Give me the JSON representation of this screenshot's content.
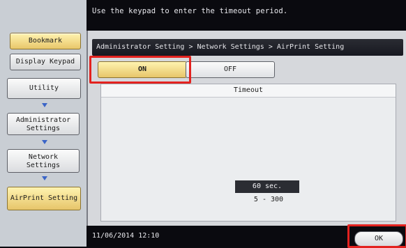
{
  "top": {
    "message": "Use the keypad to enter the timeout period."
  },
  "sidebar": {
    "bookmark": "Bookmark",
    "display_keypad": "Display Keypad",
    "steps": [
      {
        "label": "Utility"
      },
      {
        "label": "Administrator\nSettings"
      },
      {
        "label": "Network\nSettings"
      },
      {
        "label": "AirPrint Setting"
      }
    ]
  },
  "main": {
    "breadcrumb": "Administrator Setting > Network Settings > AirPrint Setting",
    "toggle_on": "ON",
    "toggle_off": "OFF",
    "section_title": "Timeout",
    "timeout_value": "60 sec.",
    "range": "5 - 300"
  },
  "footer": {
    "datetime": "11/06/2014 12:10",
    "ok": "OK"
  },
  "colors": {
    "highlight_red": "#e3221f",
    "gold": "#e7c66a",
    "dark_bar": "#0a0a0f"
  }
}
